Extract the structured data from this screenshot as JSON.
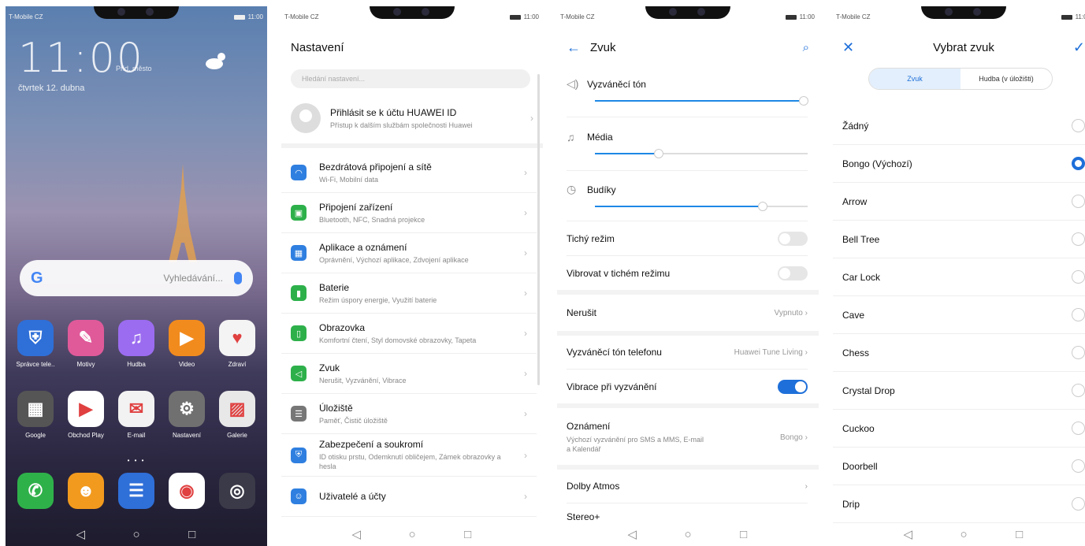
{
  "status": {
    "carrier": "T-Mobile CZ",
    "time": "11:00"
  },
  "home": {
    "time": "11:00",
    "city": "Přid. město",
    "date": "čtvrtek 12. dubna",
    "search_placeholder": "Vyhledávání...",
    "apps_row1": [
      {
        "label": "Správce tele..",
        "color": "#2f6fd8",
        "icon": "shield-icon",
        "glyph": "⛨"
      },
      {
        "label": "Motivy",
        "color": "#e05a9a",
        "icon": "themes-icon",
        "glyph": "✎"
      },
      {
        "label": "Hudba",
        "color": "#9b6cf0",
        "icon": "music-icon",
        "glyph": "♫"
      },
      {
        "label": "Video",
        "color": "#f28b1e",
        "icon": "video-icon",
        "glyph": "▶"
      },
      {
        "label": "Zdraví",
        "color": "#f4f4f4",
        "icon": "health-icon",
        "glyph": "♥"
      }
    ],
    "apps_row2": [
      {
        "label": "Google",
        "color": "#555555",
        "icon": "google-folder-icon",
        "glyph": "▦"
      },
      {
        "label": "Obchod Play",
        "color": "#ffffff",
        "icon": "play-store-icon",
        "glyph": "▶"
      },
      {
        "label": "E-mail",
        "color": "#f2f2f2",
        "icon": "email-icon",
        "glyph": "✉"
      },
      {
        "label": "Nastavení",
        "color": "#707070",
        "icon": "settings-icon",
        "glyph": "⚙"
      },
      {
        "label": "Galerie",
        "color": "#e8e8e8",
        "icon": "gallery-icon",
        "glyph": "▨"
      }
    ],
    "dock": [
      {
        "color": "#2fb14a",
        "icon": "phone-icon",
        "glyph": "✆"
      },
      {
        "color": "#f29a1e",
        "icon": "contacts-icon",
        "glyph": "☻"
      },
      {
        "color": "#2f6fd8",
        "icon": "messages-icon",
        "glyph": "☰"
      },
      {
        "color": "#ffffff",
        "icon": "chrome-icon",
        "glyph": "◉"
      },
      {
        "color": "#3a3a48",
        "icon": "camera-icon",
        "glyph": "◎"
      }
    ]
  },
  "settings": {
    "title": "Nastavení",
    "search_placeholder": "Hledání nastavení...",
    "profile_title": "Přihlásit se k účtu HUAWEI ID",
    "profile_sub": "Přístup k dalším službám společnosti Huawei",
    "items": [
      {
        "title": "Bezdrátová připojení a sítě",
        "sub": "Wi-Fi, Mobilní data",
        "color": "#2f7fe0",
        "icon": "wifi-icon",
        "glyph": "◠"
      },
      {
        "title": "Připojení zařízení",
        "sub": "Bluetooth, NFC, Snadná projekce",
        "color": "#2db04a",
        "icon": "device-connect-icon",
        "glyph": "▣"
      },
      {
        "title": "Aplikace a oznámení",
        "sub": "Oprávnění, Výchozí aplikace, Zdvojení aplikace",
        "color": "#2f7fe0",
        "icon": "apps-icon",
        "glyph": "▦"
      },
      {
        "title": "Baterie",
        "sub": "Režim úspory energie, Využití baterie",
        "color": "#2db04a",
        "icon": "battery-icon",
        "glyph": "▮"
      },
      {
        "title": "Obrazovka",
        "sub": "Komfortní čtení, Styl domovské obrazovky, Tapeta",
        "color": "#2db04a",
        "icon": "display-icon",
        "glyph": "▯"
      },
      {
        "title": "Zvuk",
        "sub": "Nerušit, Vyzvánění, Vibrace",
        "color": "#2db04a",
        "icon": "sound-icon",
        "glyph": "◁"
      },
      {
        "title": "Úložiště",
        "sub": "Paměť, Čistič úložiště",
        "color": "#777777",
        "icon": "storage-icon",
        "glyph": "☰"
      },
      {
        "title": "Zabezpečení a soukromí",
        "sub": "ID otisku prstu, Odemknutí obličejem, Zámek obrazovky a hesla",
        "color": "#2f7fe0",
        "icon": "security-icon",
        "glyph": "⛨"
      },
      {
        "title": "Uživatelé a účty",
        "sub": "",
        "color": "#2f7fe0",
        "icon": "users-icon",
        "glyph": "☺"
      }
    ]
  },
  "sound": {
    "title": "Zvuk",
    "ringtone_label": "Vyzváněcí tón",
    "ringtone_level": 0.98,
    "media_label": "Média",
    "media_level": 0.3,
    "alarm_label": "Budíky",
    "alarm_level": 0.79,
    "silent_label": "Tichý režim",
    "vibrate_silent_label": "Vibrovat v tichém režimu",
    "dnd_label": "Nerušit",
    "dnd_value": "Vypnuto",
    "phone_ringtone_label": "Vyzváněcí tón telefonu",
    "phone_ringtone_value": "Huawei Tune Living",
    "vibrate_ring_label": "Vibrace při vyzvánění",
    "notif_label": "Oznámení",
    "notif_sub": "Výchozí vyzvánění pro SMS a MMS, E-mail a Kalendář",
    "notif_value": "Bongo",
    "dolby_label": "Dolby Atmos",
    "stereo_label": "Stereo+"
  },
  "choose": {
    "title": "Vybrat zvuk",
    "tab_sound": "Zvuk",
    "tab_music": "Hudba (v úložišti)",
    "options": [
      "Žádný",
      "Bongo (Výchozí)",
      "Arrow",
      "Bell Tree",
      "Car Lock",
      "Cave",
      "Chess",
      "Crystal Drop",
      "Cuckoo",
      "Doorbell",
      "Drip"
    ],
    "selected": 1
  }
}
